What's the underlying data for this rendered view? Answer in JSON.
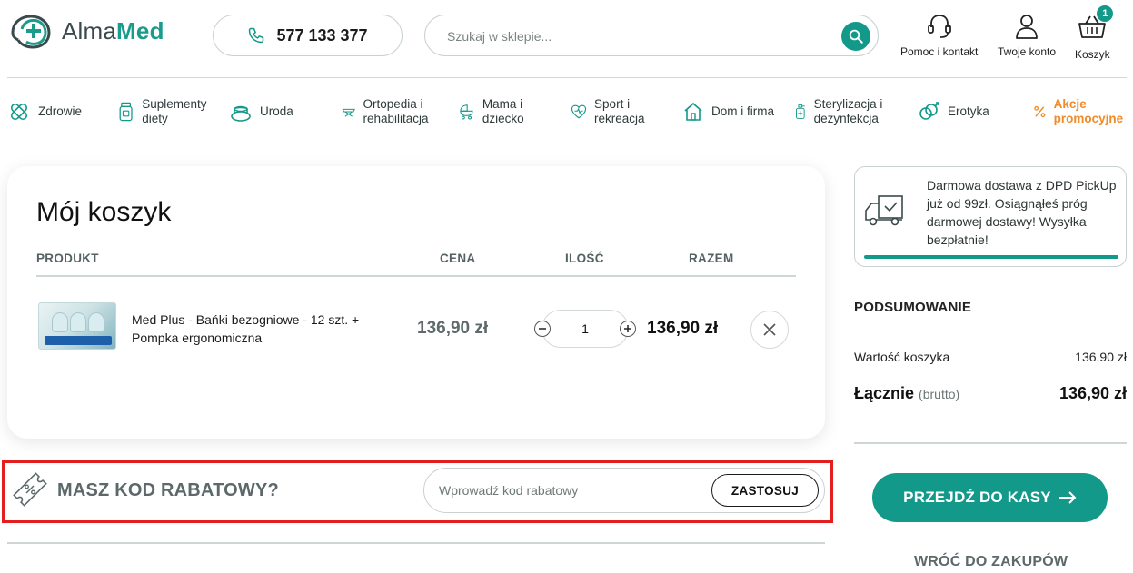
{
  "brand": {
    "name_part1": "Alma",
    "name_part2": "Med",
    "accent": "#12998a",
    "promo_color": "#f08b2a",
    "highlight_color": "#e21e1e"
  },
  "header": {
    "phone": "577 133 377",
    "search_placeholder": "Szukaj w sklepie...",
    "help_label": "Pomoc i kontakt",
    "account_label": "Twoje konto",
    "cart_label": "Koszyk",
    "cart_count": "1"
  },
  "categories": [
    {
      "label": "Zdrowie",
      "icon": "bandage-icon"
    },
    {
      "label": "Suplementy diety",
      "icon": "pill-bottle-icon"
    },
    {
      "label": "Uroda",
      "icon": "cosmetics-icon"
    },
    {
      "label": "Ortopedia i rehabilitacja",
      "icon": "rehab-bed-icon"
    },
    {
      "label": "Mama i dziecko",
      "icon": "stroller-icon"
    },
    {
      "label": "Sport i rekreacja",
      "icon": "fitness-icon"
    },
    {
      "label": "Dom i firma",
      "icon": "house-icon"
    },
    {
      "label": "Sterylizacja i dezynfekcja",
      "icon": "disinfectant-icon"
    },
    {
      "label": "Erotyka",
      "icon": "gender-icon"
    },
    {
      "label": "Akcje promocyjne",
      "icon": "percent-icon"
    }
  ],
  "cart": {
    "title": "Mój koszyk",
    "columns": {
      "product": "PRODUKT",
      "price": "CENA",
      "qty": "ILOŚĆ",
      "total": "RAZEM"
    },
    "items": [
      {
        "name": "Med Plus - Bańki bezogniowe - 12 szt. + Pompka ergonomiczna",
        "price": "136,90 zł",
        "qty": "1",
        "total": "136,90 zł"
      }
    ]
  },
  "discount": {
    "label": "MASZ KOD RABATOWY?",
    "placeholder": "Wprowadź kod rabatowy",
    "apply": "ZASTOSUJ"
  },
  "shipping": {
    "text": "Darmowa dostawa z DPD PickUp już od 99zł. Osiągnąłeś próg darmowej dostawy! Wysyłka bezpłatnie!",
    "progress": 1.0
  },
  "summary": {
    "title": "PODSUMOWANIE",
    "cart_value_label": "Wartość koszyka",
    "cart_value": "136,90 zł",
    "total_label": "Łącznie",
    "total_note": "(brutto)",
    "total_value": "136,90 zł",
    "checkout": "PRZEJDŹ DO KASY",
    "back": "WRÓĆ DO ZAKUPÓW"
  }
}
